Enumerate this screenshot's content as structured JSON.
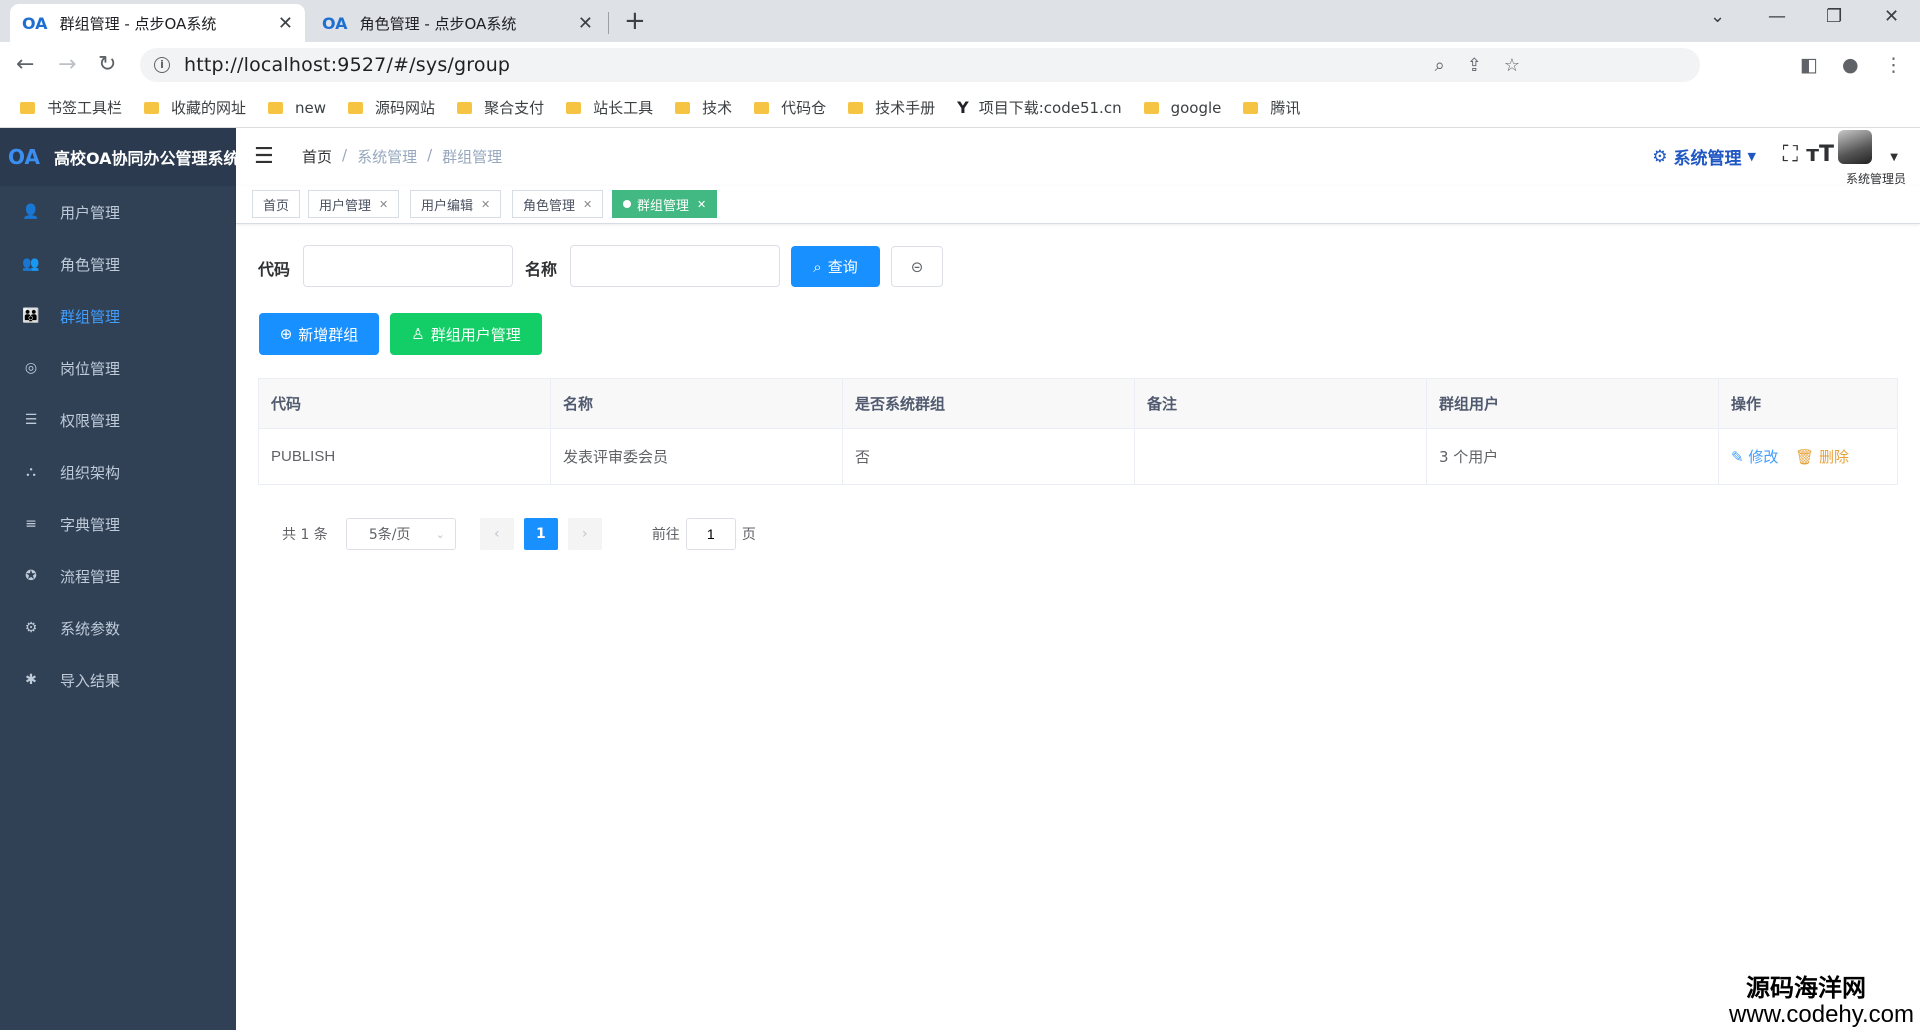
{
  "browser": {
    "tabs": [
      {
        "favicon": "OA",
        "title": "群组管理 - 点步OA系统",
        "close": "✕"
      },
      {
        "favicon": "OA",
        "title": "角色管理 - 点步OA系统",
        "close": "✕"
      }
    ],
    "new_tab": "+",
    "url": "http://localhost:9527/#/sys/group",
    "bookmarks": [
      "书签工具栏",
      "收藏的网址",
      "new",
      "源码网站",
      "聚合支付",
      "站长工具",
      "技术",
      "代码仓",
      "技术手册",
      "项目下载:code51.cn",
      "google",
      "腾讯"
    ],
    "bookmark_icon_letter": "Y"
  },
  "app": {
    "logo_mark": "OA",
    "name": "高校OA协同办公管理系统",
    "menu": [
      {
        "label": "用户管理",
        "icon": "user-icon",
        "glyph": "👤"
      },
      {
        "label": "角色管理",
        "icon": "role-icon",
        "glyph": "👥"
      },
      {
        "label": "群组管理",
        "icon": "group-icon",
        "glyph": "👪",
        "active": true
      },
      {
        "label": "岗位管理",
        "icon": "post-icon",
        "glyph": "◎"
      },
      {
        "label": "权限管理",
        "icon": "permission-icon",
        "glyph": "☰"
      },
      {
        "label": "组织架构",
        "icon": "org-icon",
        "glyph": "⛬"
      },
      {
        "label": "字典管理",
        "icon": "dict-icon",
        "glyph": "≡"
      },
      {
        "label": "流程管理",
        "icon": "flow-icon",
        "glyph": "✪"
      },
      {
        "label": "系统参数",
        "icon": "settings-icon",
        "glyph": "⚙"
      },
      {
        "label": "导入结果",
        "icon": "import-icon",
        "glyph": "✱"
      }
    ],
    "breadcrumb": [
      "首页",
      "系统管理",
      "群组管理"
    ],
    "sys_menu": "系统管理",
    "username": "系统管理员",
    "tags": [
      {
        "label": "首页",
        "closable": false
      },
      {
        "label": "用户管理",
        "closable": true
      },
      {
        "label": "用户编辑",
        "closable": true
      },
      {
        "label": "角色管理",
        "closable": true
      },
      {
        "label": "群组管理",
        "closable": true,
        "active": true
      }
    ],
    "colors": {
      "sidebar": "#304156",
      "primary": "#1890ff",
      "success": "#13ce66",
      "tag_active": "#42b983"
    }
  },
  "filter": {
    "code_label": "代码",
    "code_value": "",
    "name_label": "名称",
    "name_value": "",
    "search_label": "查询"
  },
  "actions": {
    "add_label": "新增群组",
    "group_user_label": "群组用户管理"
  },
  "table": {
    "columns": [
      "代码",
      "名称",
      "是否系统群组",
      "备注",
      "群组用户",
      "操作"
    ],
    "rows": [
      {
        "code": "PUBLISH",
        "name": "发表评审委会员",
        "is_system": "否",
        "remark": "",
        "users": "3 个用户",
        "edit": "修改",
        "delete": "删除"
      }
    ]
  },
  "pagination": {
    "total": "共 1 条",
    "page_size": "5条/页",
    "current": "1",
    "goto": "前往",
    "goto_value": "1",
    "page_suffix": "页"
  },
  "watermark": {
    "line1": "源码海洋网",
    "line2": "www.codehy.com"
  }
}
